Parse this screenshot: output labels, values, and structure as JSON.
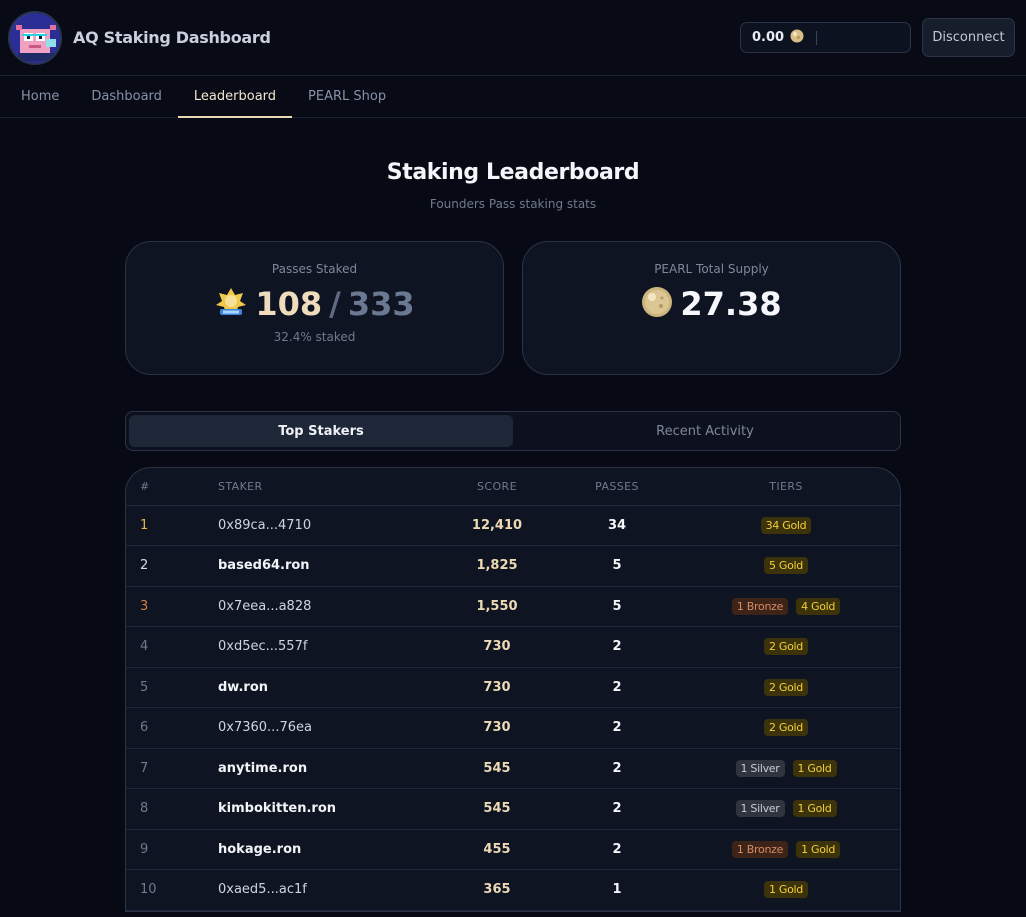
{
  "app": {
    "title": "AQ Staking Dashboard"
  },
  "wallet": {
    "balance": "0.00",
    "disconnect_label": "Disconnect"
  },
  "nav": {
    "tabs": [
      "Home",
      "Dashboard",
      "Leaderboard",
      "PEARL Shop"
    ],
    "active": "Leaderboard"
  },
  "page": {
    "title": "Staking Leaderboard",
    "subtitle": "Founders Pass staking stats"
  },
  "stats": {
    "passes": {
      "label": "Passes Staked",
      "value": "108",
      "separator": "/",
      "total": "333",
      "note": "32.4% staked"
    },
    "supply": {
      "label": "PEARL Total Supply",
      "value": "27.38"
    }
  },
  "view_tabs": {
    "top_stakers": "Top Stakers",
    "recent_activity": "Recent Activity"
  },
  "table": {
    "headers": {
      "rank": "#",
      "staker": "STAKER",
      "score": "SCORE",
      "passes": "PASSES",
      "tiers": "TIERS"
    },
    "rows": [
      {
        "rank": "1",
        "staker": "0x89ca...4710",
        "score": "12,410",
        "passes": "34",
        "tiers": [
          {
            "label": "34 Gold",
            "kind": "gold"
          }
        ]
      },
      {
        "rank": "2",
        "staker": "based64.ron",
        "score": "1,825",
        "passes": "5",
        "tiers": [
          {
            "label": "5 Gold",
            "kind": "gold"
          }
        ]
      },
      {
        "rank": "3",
        "staker": "0x7eea...a828",
        "score": "1,550",
        "passes": "5",
        "tiers": [
          {
            "label": "1 Bronze",
            "kind": "bronze"
          },
          {
            "label": "4 Gold",
            "kind": "gold"
          }
        ]
      },
      {
        "rank": "4",
        "staker": "0xd5ec...557f",
        "score": "730",
        "passes": "2",
        "tiers": [
          {
            "label": "2 Gold",
            "kind": "gold"
          }
        ]
      },
      {
        "rank": "5",
        "staker": "dw.ron",
        "score": "730",
        "passes": "2",
        "tiers": [
          {
            "label": "2 Gold",
            "kind": "gold"
          }
        ]
      },
      {
        "rank": "6",
        "staker": "0x7360...76ea",
        "score": "730",
        "passes": "2",
        "tiers": [
          {
            "label": "2 Gold",
            "kind": "gold"
          }
        ]
      },
      {
        "rank": "7",
        "staker": "anytime.ron",
        "score": "545",
        "passes": "2",
        "tiers": [
          {
            "label": "1 Silver",
            "kind": "silver"
          },
          {
            "label": "1 Gold",
            "kind": "gold"
          }
        ]
      },
      {
        "rank": "8",
        "staker": "kimbokitten.ron",
        "score": "545",
        "passes": "2",
        "tiers": [
          {
            "label": "1 Silver",
            "kind": "silver"
          },
          {
            "label": "1 Gold",
            "kind": "gold"
          }
        ]
      },
      {
        "rank": "9",
        "staker": "hokage.ron",
        "score": "455",
        "passes": "2",
        "tiers": [
          {
            "label": "1 Bronze",
            "kind": "bronze"
          },
          {
            "label": "1 Gold",
            "kind": "gold"
          }
        ]
      },
      {
        "rank": "10",
        "staker": "0xaed5...ac1f",
        "score": "365",
        "passes": "1",
        "tiers": [
          {
            "label": "1 Gold",
            "kind": "gold"
          }
        ]
      }
    ]
  },
  "icons": {
    "logo": "axolotl-avatar-logo",
    "pearl": "pearl-coin-icon",
    "pass": "founders-pass-shell-icon"
  },
  "colors": {
    "accent": "#e8d8b4",
    "gold": "#f3cf3b",
    "silver": "#c5cad4",
    "bronze": "#d88c64",
    "background": "#070a14"
  }
}
